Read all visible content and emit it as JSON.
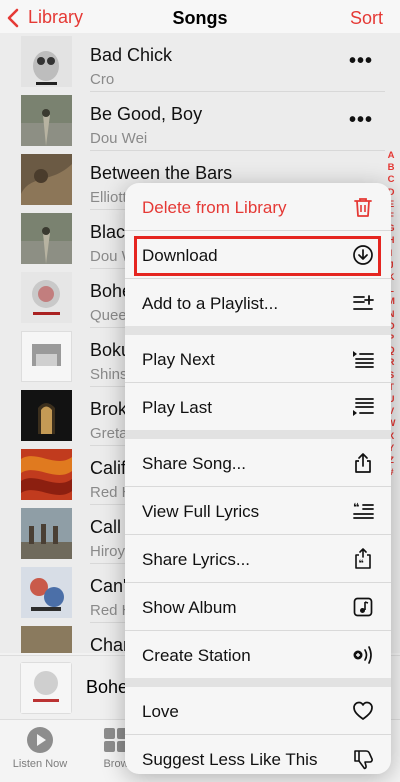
{
  "header": {
    "back_label": "Library",
    "title": "Songs",
    "sort_label": "Sort"
  },
  "songs": [
    {
      "title": "Bad Chick",
      "artist": "Cro",
      "art": "#d9d9d9"
    },
    {
      "title": "Be Good, Boy",
      "artist": "Dou Wei",
      "art": "#6f7766"
    },
    {
      "title": "Between the Bars",
      "artist": "Elliott",
      "art": "#6b5a44"
    },
    {
      "title": "Black",
      "artist": "Dou W",
      "art": "#6f7766"
    },
    {
      "title": "Bohe",
      "artist": "Quee",
      "art": "#e8e8e8"
    },
    {
      "title": "Boku",
      "artist": "Shins",
      "art": "#f2f2f2"
    },
    {
      "title": "Brok",
      "artist": "Greta",
      "art": "#1a1a1a"
    },
    {
      "title": "Calif",
      "artist": "Red H",
      "art": "#c13b1e"
    },
    {
      "title": "Call",
      "artist": "Hiroy",
      "art": "#7b8a90"
    },
    {
      "title": "Can'",
      "artist": "Red H",
      "art": "#cfd7e3"
    },
    {
      "title": "Char",
      "artist": "",
      "art": "#8a7a5e"
    }
  ],
  "index_letters": [
    "A",
    "B",
    "C",
    "D",
    "E",
    "F",
    "G",
    "H",
    "I",
    "J",
    "K",
    "L",
    "M",
    "N",
    "O",
    "P",
    "Q",
    "R",
    "S",
    "T",
    "U",
    "V",
    "W",
    "X",
    "Y",
    "Z",
    "#"
  ],
  "player": {
    "title": "Bohe"
  },
  "tabs": [
    {
      "label": "Listen Now"
    },
    {
      "label": "Brow"
    }
  ],
  "menu": {
    "delete": "Delete from Library",
    "download": "Download",
    "add_playlist": "Add to a Playlist...",
    "play_next": "Play Next",
    "play_last": "Play Last",
    "share_song": "Share Song...",
    "view_lyrics": "View Full Lyrics",
    "share_lyrics": "Share Lyrics...",
    "show_album": "Show Album",
    "create_station": "Create Station",
    "love": "Love",
    "suggest_less": "Suggest Less Like This"
  },
  "colors": {
    "accent": "#e53935",
    "highlight_box": "#e52520"
  }
}
